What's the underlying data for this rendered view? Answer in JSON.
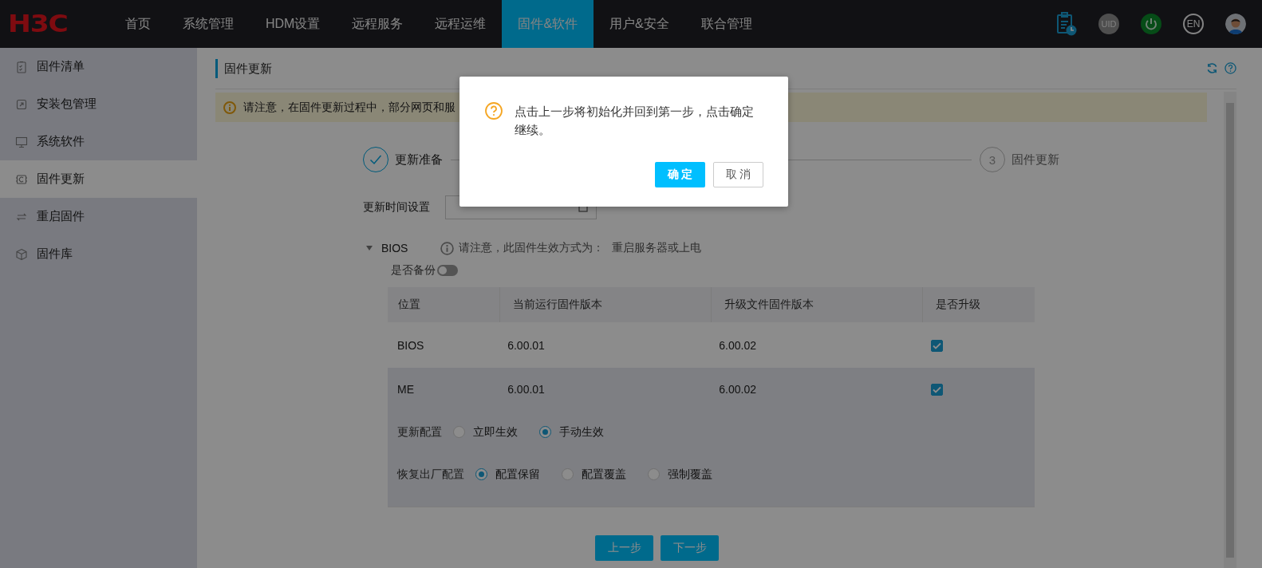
{
  "nav": {
    "logo": "H3C",
    "items": [
      {
        "label": "首页",
        "selected": false
      },
      {
        "label": "系统管理",
        "selected": false
      },
      {
        "label": "HDM设置",
        "selected": false
      },
      {
        "label": "远程服务",
        "selected": false
      },
      {
        "label": "远程运维",
        "selected": false
      },
      {
        "label": "固件&软件",
        "selected": true
      },
      {
        "label": "用户&安全",
        "selected": false
      },
      {
        "label": "联合管理",
        "selected": false
      }
    ],
    "icons": [
      {
        "kind": "tasks"
      },
      {
        "kind": "uid",
        "label": "UID"
      },
      {
        "kind": "power"
      },
      {
        "kind": "language",
        "label": "EN"
      },
      {
        "kind": "avatar"
      }
    ]
  },
  "sidebar": {
    "items": [
      {
        "label": "固件清单",
        "kind": "list",
        "selected": false
      },
      {
        "label": "安装包管理",
        "kind": "package",
        "selected": false
      },
      {
        "label": "系统软件",
        "kind": "monitor",
        "selected": false
      },
      {
        "label": "固件更新",
        "kind": "chip",
        "selected": true
      },
      {
        "label": "重启固件",
        "kind": "cycle",
        "selected": false
      },
      {
        "label": "固件库",
        "kind": "cube",
        "selected": false
      }
    ]
  },
  "page": {
    "title": "固件更新",
    "notice": "请注意，在固件更新过程中，部分网页和服",
    "steps": [
      {
        "kind": "done",
        "label": "更新准备"
      },
      {
        "kind": "pending",
        "number": "3",
        "label": "固件更新"
      }
    ],
    "time_setting": {
      "label": "更新时间设置"
    },
    "firmware": {
      "name": "BIOS",
      "expanded": true,
      "note": "请注意，此固件生效方式为：",
      "effect": "重启服务器或上电",
      "backup": {
        "label": "是否备份",
        "on": false
      }
    },
    "table": {
      "columns": [
        "位置",
        "当前运行固件版本",
        "升级文件固件版本",
        "是否升级"
      ],
      "rows": [
        {
          "cells": [
            "BIOS",
            "6.00.01",
            "6.00.02"
          ],
          "upgrade": true,
          "highlighted": false
        },
        {
          "cells": [
            "ME",
            "6.00.01",
            "6.00.02"
          ],
          "upgrade": true,
          "highlighted": true
        }
      ]
    },
    "options": [
      {
        "label": "更新配置",
        "choices": [
          {
            "label": "立即生效",
            "selected": false
          },
          {
            "label": "手动生效",
            "selected": true
          }
        ]
      },
      {
        "label": "恢复出厂配置",
        "choices": [
          {
            "label": "配置保留",
            "selected": true
          },
          {
            "label": "配置覆盖",
            "selected": false
          },
          {
            "label": "强制覆盖",
            "selected": false
          }
        ]
      }
    ],
    "buttons": [
      {
        "label": "上一步"
      },
      {
        "label": "下一步"
      }
    ]
  },
  "dialog": {
    "message": "点击上一步将初始化并回到第一步，点击确定继续。",
    "buttons": [
      {
        "label": "确 定",
        "kind": "primary"
      },
      {
        "label": "取 消",
        "kind": "default"
      }
    ]
  }
}
